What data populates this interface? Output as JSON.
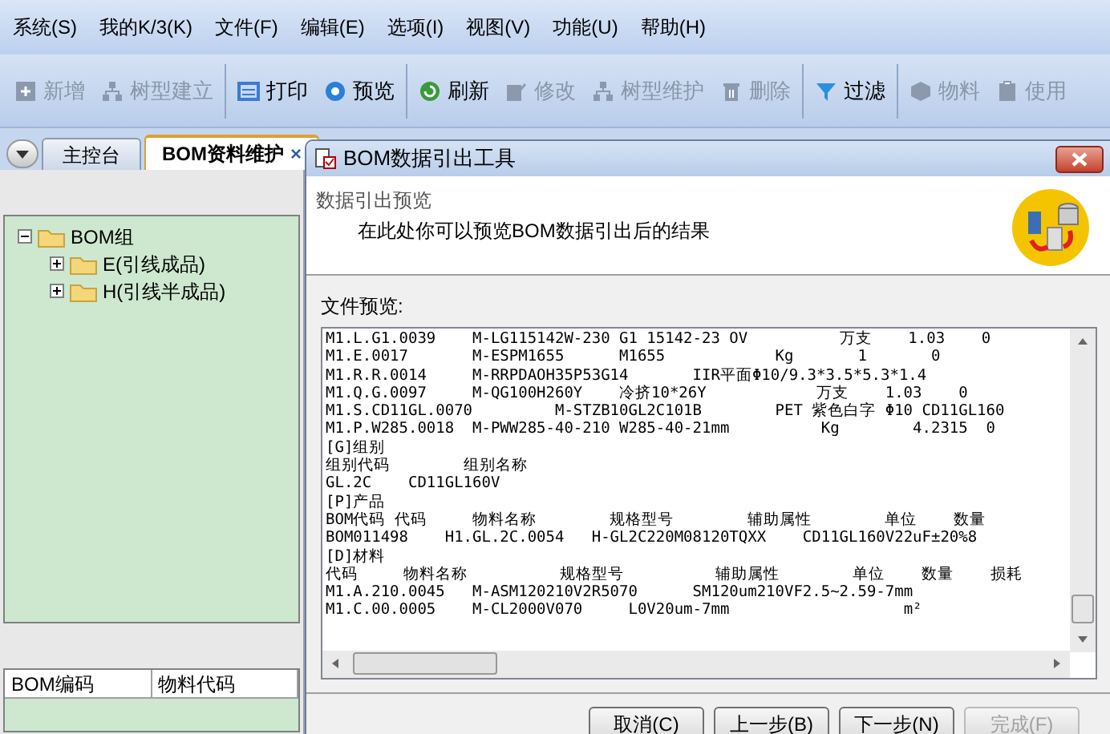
{
  "menu": [
    "系统(S)",
    "我的K/3(K)",
    "文件(F)",
    "编辑(E)",
    "选项(I)",
    "视图(V)",
    "功能(U)",
    "帮助(H)"
  ],
  "toolbar": [
    {
      "label": "新增",
      "disabled": true,
      "separator_after": false
    },
    {
      "label": "树型建立",
      "disabled": true,
      "separator_after": true
    },
    {
      "label": "打印",
      "disabled": false,
      "separator_after": false
    },
    {
      "label": "预览",
      "disabled": false,
      "separator_after": true
    },
    {
      "label": "刷新",
      "disabled": false,
      "separator_after": false
    },
    {
      "label": "修改",
      "disabled": true,
      "separator_after": false
    },
    {
      "label": "树型维护",
      "disabled": true,
      "separator_after": false
    },
    {
      "label": "删除",
      "disabled": true,
      "separator_after": true
    },
    {
      "label": "过滤",
      "disabled": false,
      "separator_after": true
    },
    {
      "label": "物料",
      "disabled": true,
      "separator_after": false
    },
    {
      "label": "使用",
      "disabled": true,
      "separator_after": false
    }
  ],
  "tabs": [
    {
      "label": "主控台",
      "selected": false
    },
    {
      "label": "BOM资料维护",
      "selected": true,
      "close": "×"
    }
  ],
  "tree": [
    {
      "label": "BOM组",
      "expanded": true,
      "children": [
        {
          "label": "E(引线成品)",
          "expanded": false
        },
        {
          "label": "H(引线半成品)",
          "expanded": false
        }
      ]
    }
  ],
  "table": {
    "columns": [
      "BOM编码",
      "物料代码"
    ]
  },
  "dialog": {
    "title": "BOM数据引出工具",
    "heading": "数据引出预览",
    "subtitle": "在此处你可以预览BOM数据引出后的结果",
    "preview_label": "文件预览:",
    "preview_lines": [
      "M1.L.G1.0039    M-LG115142W-230 G1 15142-23 OV          万支    1.03    0",
      "M1.E.0017       M-ESPM1655      M1655            Kg       1       0",
      "M1.R.R.0014     M-RRPDAOH35P53G14       IIR平面Φ10/9.3*3.5*5.3*1.4",
      "M1.Q.G.0097     M-QG100H260Y    冷挤10*26Y            万支    1.03    0",
      "M1.S.CD11GL.0070         M-STZB10GL2C101B        PET 紫色白字 Φ10 CD11GL160",
      "M1.P.W285.0018  M-PWW285-40-210 W285-40-21mm          Kg        4.2315  0",
      "[G]组别",
      "组别代码        组别名称",
      "GL.2C    CD11GL160V",
      "[P]产品",
      "BOM代码 代码     物料名称        规格型号        辅助属性        单位    数量",
      "BOM011498    H1.GL.2C.0054   H-GL2C220M08120TQXX    CD11GL160V22uF±20%8",
      "[D]材料",
      "代码     物料名称          规格型号          辅助属性        单位    数量    损耗",
      "M1.A.210.0045   M-ASM120210V2R5070      SM120um210VF2.5~2.59-7mm",
      "M1.C.00.0005    M-CL2000V070     L0V20um-7mm                   m²"
    ],
    "buttons": [
      {
        "label": "取消(C)",
        "disabled": false
      },
      {
        "label": "上一步(B)",
        "disabled": false
      },
      {
        "label": "下一步(N)",
        "disabled": false
      },
      {
        "label": "完成(F)",
        "disabled": true
      }
    ]
  }
}
